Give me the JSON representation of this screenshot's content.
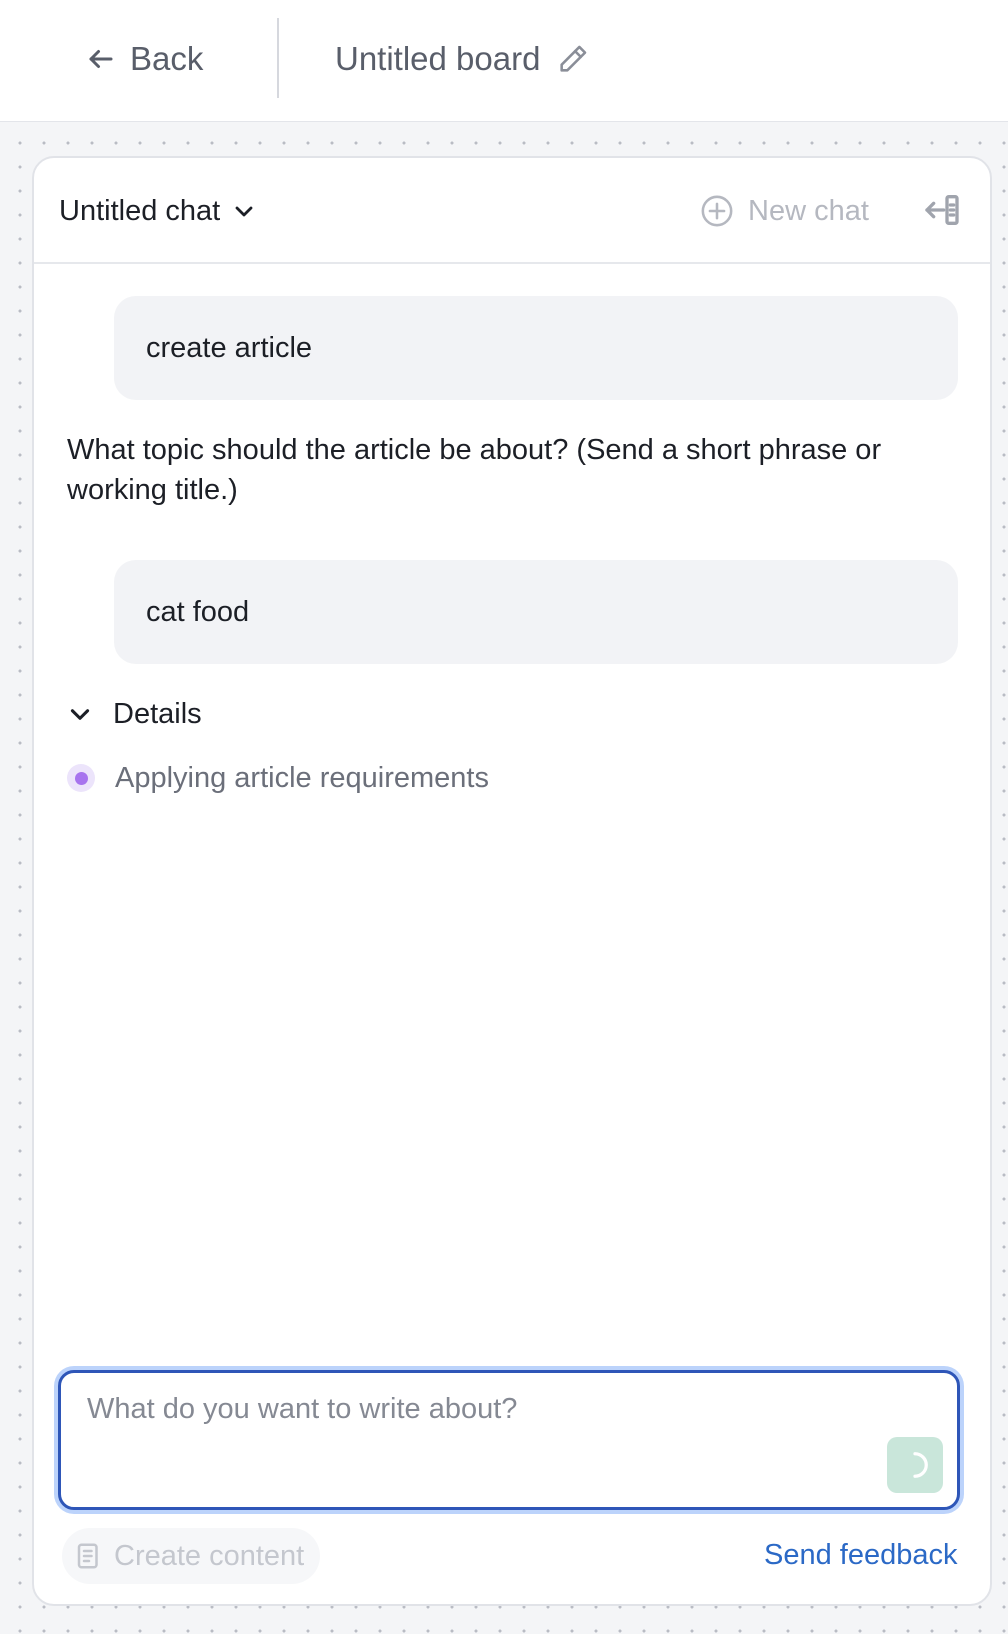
{
  "topbar": {
    "back_label": "Back",
    "board_title": "Untitled board",
    "icons": {
      "back": "arrow-left-icon",
      "edit": "pencil-icon"
    }
  },
  "chat": {
    "title": "Untitled chat",
    "new_chat_label": "New chat",
    "icons": {
      "title_menu": "chevron-down-icon",
      "new_chat": "plus-circle-icon",
      "collapse": "collapse-panel-icon"
    }
  },
  "messages": [
    {
      "role": "user",
      "text": "create article"
    },
    {
      "role": "assistant",
      "text": "What topic should the article be about? (Send a short phrase or working title.)"
    },
    {
      "role": "user",
      "text": "cat food"
    }
  ],
  "details": {
    "label": "Details",
    "status_text": "Applying article requirements",
    "status_color": "#a774ee"
  },
  "composer": {
    "placeholder": "What do you want to write about?",
    "value": "",
    "send_icon": "loading-spinner-icon"
  },
  "footer": {
    "create_content_label": "Create content",
    "send_feedback_label": "Send feedback",
    "create_icon": "document-icon"
  },
  "colors": {
    "accent_blue": "#2e56b8",
    "link_blue": "#2b69c6",
    "send_button_bg": "#c9e6da",
    "status_purple": "#a774ee"
  }
}
